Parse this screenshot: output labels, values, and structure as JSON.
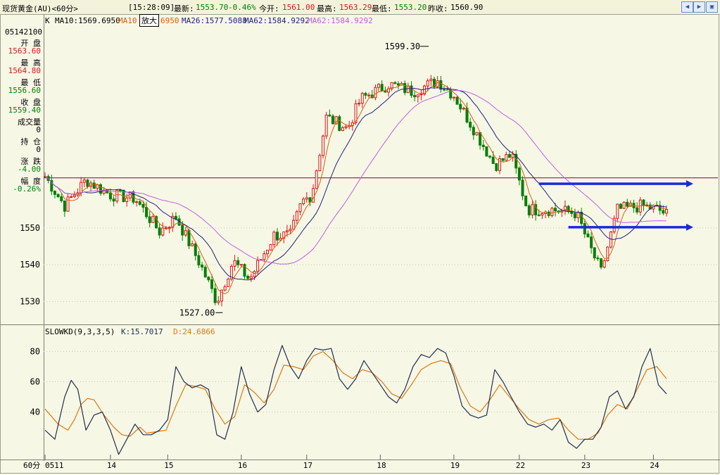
{
  "header": {
    "symbol": "现货黄金(AU)<60分>",
    "time": "[15:28:09]",
    "latest_label": "最新:",
    "latest_value": "1553.70",
    "change": "-0.46%",
    "open_label": "今开:",
    "open_value": "1561.00",
    "high_label": "最高:",
    "high_value": "1563.29",
    "low_label": "最低:",
    "low_value": "1553.20",
    "prev_label": "昨收:",
    "prev_value": "1560.90"
  },
  "ma_legend": {
    "k": "K",
    "ma10": "MA10:1569.6950",
    "ma10b_prefix": "MA10",
    "zoom_label": "放大",
    "ma10b_suffix": "6950",
    "ma26": "MA26:1577.5088",
    "ma62": "MA62:1584.9292",
    "ma62b": "MA62:1584.9292"
  },
  "side_panel": {
    "date": "05142100",
    "open_label": "开  盘",
    "open_value": "1563.60",
    "high_label": "最  高",
    "high_value": "1564.80",
    "low_label": "最  低",
    "low_value": "1556.60",
    "close_label": "收  盘",
    "close_value": "1559.40",
    "volume_label": "成交量",
    "volume_value": "0",
    "position_label": "持  仓",
    "position_value": "0",
    "change_label": "涨  跌",
    "change_value": "-4.00",
    "range_label": "幅  度",
    "range_value": "-0.26%"
  },
  "kd_legend": {
    "name": "SLOWKD(9,3,3,5)",
    "k": "K:15.7017",
    "d": "D:24.6866"
  },
  "colors": {
    "up": "#d81818",
    "down": "#008000",
    "ma10": "#d86010",
    "ma26": "#202080",
    "ma62": "#c060e0",
    "hline": "#800040",
    "arrow": "#1a2ad8",
    "kline": "#203050",
    "dline": "#e07810"
  },
  "chart_data": [
    {
      "type": "candlestick",
      "title": "现货黄金(AU)<60分>",
      "ylim": [
        1524,
        1605
      ],
      "y_ticks": [
        1530,
        1540,
        1550
      ],
      "x_tick_labels": [
        "0511",
        "14",
        "15",
        "16",
        "17",
        "18",
        "19",
        "22",
        "23",
        "24"
      ],
      "x_label_corner": "60分",
      "annotations": [
        {
          "text": "1599.30",
          "value": 1599.3
        },
        {
          "text": "1527.00",
          "value": 1527.0
        }
      ],
      "horizontal_line": 1563.6,
      "arrow_lines": [
        1562.0,
        1550.2
      ],
      "key_points": [
        [
          0,
          1564
        ],
        [
          12,
          1556
        ],
        [
          25,
          1563
        ],
        [
          40,
          1559
        ],
        [
          55,
          1558
        ],
        [
          70,
          1549
        ],
        [
          80,
          1553
        ],
        [
          95,
          1540
        ],
        [
          105,
          1530
        ],
        [
          115,
          1541
        ],
        [
          125,
          1536
        ],
        [
          140,
          1548
        ],
        [
          150,
          1548
        ],
        [
          157,
          1557
        ],
        [
          163,
          1559
        ],
        [
          172,
          1580
        ],
        [
          185,
          1577
        ],
        [
          193,
          1585
        ],
        [
          210,
          1589
        ],
        [
          225,
          1587
        ],
        [
          240,
          1590
        ],
        [
          250,
          1586
        ],
        [
          262,
          1577
        ],
        [
          275,
          1567
        ],
        [
          285,
          1570
        ],
        [
          295,
          1555
        ],
        [
          310,
          1555
        ],
        [
          325,
          1554
        ],
        [
          333,
          1545
        ],
        [
          340,
          1538
        ],
        [
          350,
          1555
        ],
        [
          365,
          1556
        ],
        [
          375,
          1555
        ],
        [
          380,
          1553.7
        ]
      ],
      "series": [
        {
          "name": "MA10",
          "value": 1569.695
        },
        {
          "name": "MA26",
          "value": 1577.5088
        },
        {
          "name": "MA62",
          "value": 1584.9292
        }
      ]
    },
    {
      "type": "line",
      "title": "SLOWKD(9,3,3,5)",
      "ylim": [
        10,
        90
      ],
      "y_ticks": [
        40,
        60,
        80
      ],
      "series": [
        {
          "name": "K",
          "value": 15.7017,
          "points": [
            [
              0,
              28
            ],
            [
              6,
              22
            ],
            [
              12,
              50
            ],
            [
              16,
              61
            ],
            [
              20,
              55
            ],
            [
              25,
              28
            ],
            [
              30,
              38
            ],
            [
              35,
              40
            ],
            [
              40,
              28
            ],
            [
              45,
              12
            ],
            [
              50,
              22
            ],
            [
              55,
              32
            ],
            [
              60,
              25
            ],
            [
              65,
              25
            ],
            [
              70,
              28
            ],
            [
              75,
              35
            ],
            [
              80,
              70
            ],
            [
              85,
              60
            ],
            [
              90,
              56
            ],
            [
              95,
              58
            ],
            [
              100,
              55
            ],
            [
              105,
              25
            ],
            [
              110,
              22
            ],
            [
              115,
              40
            ],
            [
              120,
              70
            ],
            [
              125,
              52
            ],
            [
              130,
              40
            ],
            [
              135,
              45
            ],
            [
              140,
              68
            ],
            [
              145,
              84
            ],
            [
              150,
              70
            ],
            [
              155,
              62
            ],
            [
              160,
              74
            ],
            [
              165,
              82
            ],
            [
              170,
              81
            ],
            [
              175,
              82
            ],
            [
              180,
              62
            ],
            [
              185,
              55
            ],
            [
              190,
              62
            ],
            [
              195,
              74
            ],
            [
              200,
              66
            ],
            [
              205,
              58
            ],
            [
              210,
              50
            ],
            [
              215,
              46
            ],
            [
              220,
              55
            ],
            [
              225,
              70
            ],
            [
              230,
              78
            ],
            [
              235,
              76
            ],
            [
              240,
              82
            ],
            [
              245,
              79
            ],
            [
              250,
              64
            ],
            [
              255,
              44
            ],
            [
              260,
              38
            ],
            [
              265,
              36
            ],
            [
              270,
              38
            ],
            [
              275,
              68
            ],
            [
              280,
              60
            ],
            [
              285,
              50
            ],
            [
              290,
              40
            ],
            [
              295,
              32
            ],
            [
              300,
              30
            ],
            [
              305,
              32
            ],
            [
              310,
              28
            ],
            [
              315,
              35
            ],
            [
              320,
              20
            ],
            [
              325,
              16
            ],
            [
              330,
              22
            ],
            [
              335,
              22
            ],
            [
              340,
              30
            ],
            [
              345,
              50
            ],
            [
              350,
              54
            ],
            [
              355,
              42
            ],
            [
              360,
              50
            ],
            [
              365,
              70
            ],
            [
              370,
              82
            ],
            [
              375,
              58
            ],
            [
              380,
              52
            ]
          ]
        },
        {
          "name": "D",
          "value": 24.6866,
          "points": [
            [
              0,
              42
            ],
            [
              8,
              32
            ],
            [
              14,
              28
            ],
            [
              18,
              35
            ],
            [
              22,
              45
            ],
            [
              26,
              49
            ],
            [
              30,
              48
            ],
            [
              36,
              38
            ],
            [
              42,
              30
            ],
            [
              47,
              25
            ],
            [
              52,
              24
            ],
            [
              58,
              30
            ],
            [
              62,
              26
            ],
            [
              68,
              27
            ],
            [
              74,
              28
            ],
            [
              80,
              44
            ],
            [
              86,
              58
            ],
            [
              92,
              57
            ],
            [
              98,
              55
            ],
            [
              104,
              42
            ],
            [
              110,
              32
            ],
            [
              116,
              37
            ],
            [
              122,
              58
            ],
            [
              128,
              53
            ],
            [
              134,
              46
            ],
            [
              140,
              55
            ],
            [
              146,
              71
            ],
            [
              152,
              70
            ],
            [
              158,
              68
            ],
            [
              164,
              77
            ],
            [
              170,
              80
            ],
            [
              176,
              74
            ],
            [
              182,
              66
            ],
            [
              188,
              62
            ],
            [
              194,
              68
            ],
            [
              200,
              66
            ],
            [
              206,
              60
            ],
            [
              212,
              52
            ],
            [
              218,
              49
            ],
            [
              224,
              58
            ],
            [
              230,
              68
            ],
            [
              236,
              72
            ],
            [
              242,
              74
            ],
            [
              248,
              72
            ],
            [
              254,
              56
            ],
            [
              260,
              44
            ],
            [
              266,
              40
            ],
            [
              272,
              48
            ],
            [
              278,
              58
            ],
            [
              284,
              50
            ],
            [
              290,
              42
            ],
            [
              296,
              35
            ],
            [
              302,
              32
            ],
            [
              308,
              35
            ],
            [
              314,
              36
            ],
            [
              320,
              28
            ],
            [
              326,
              22
            ],
            [
              332,
              22
            ],
            [
              338,
              26
            ],
            [
              344,
              38
            ],
            [
              350,
              45
            ],
            [
              356,
              42
            ],
            [
              362,
              55
            ],
            [
              368,
              68
            ],
            [
              374,
              70
            ],
            [
              380,
              62
            ]
          ]
        }
      ]
    }
  ]
}
